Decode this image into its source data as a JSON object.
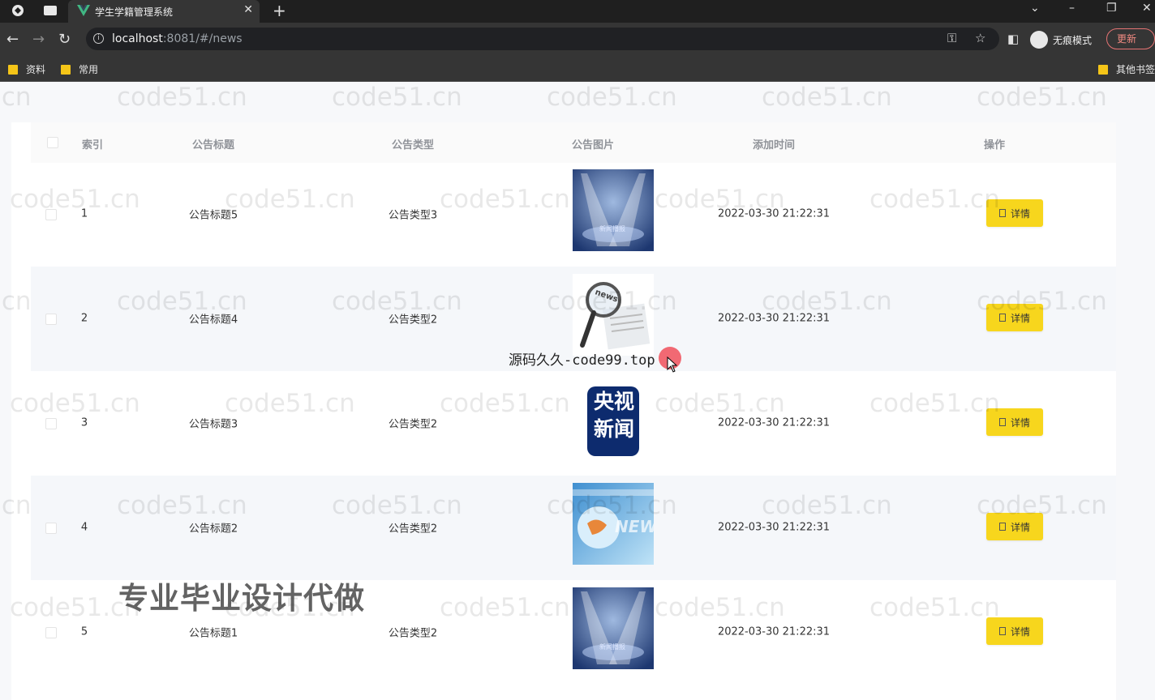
{
  "browser": {
    "tab_title": "学生学籍管理系统",
    "url_host": "localhost",
    "url_rest": ":8081/#/news",
    "incognito_label": "无痕模式",
    "update_label": "更新",
    "bookmarks": [
      "资料",
      "常用"
    ],
    "other_bookmarks": "其他书签"
  },
  "table": {
    "headers": {
      "index": "索引",
      "title": "公告标题",
      "type": "公告类型",
      "image": "公告图片",
      "time": "添加时间",
      "action": "操作"
    },
    "rows": [
      {
        "index": "1",
        "title": "公告标题5",
        "type": "公告类型3",
        "image": "stage-spotlight-news",
        "time": "2022-03-30 21:22:31",
        "action": "详情"
      },
      {
        "index": "2",
        "title": "公告标题4",
        "type": "公告类型2",
        "image": "news-magnifier",
        "time": "2022-03-30 21:22:31",
        "action": "详情"
      },
      {
        "index": "3",
        "title": "公告标题3",
        "type": "公告类型2",
        "image": "cctv-news-logo",
        "time": "2022-03-30 21:22:31",
        "action": "详情"
      },
      {
        "index": "4",
        "title": "公告标题2",
        "type": "公告类型2",
        "image": "globe-news",
        "time": "2022-03-30 21:22:31",
        "action": "详情"
      },
      {
        "index": "5",
        "title": "公告标题1",
        "type": "公告类型2",
        "image": "stage-spotlight-news",
        "time": "2022-03-30 21:22:31",
        "action": "详情"
      }
    ]
  },
  "images": {
    "stage_caption": "新闻播报",
    "news_word": "news",
    "cctv_line1": "央视",
    "cctv_line2": "新闻",
    "globe_word": "NEWS"
  },
  "overlays": {
    "watermark": "code51.cn",
    "source_text": "源码久久-code99.top",
    "ad_text": "专业毕业设计代做"
  },
  "colors": {
    "detail_button": "#f7d61d",
    "header_text": "#909399",
    "stripe": "#f5f7fa"
  }
}
